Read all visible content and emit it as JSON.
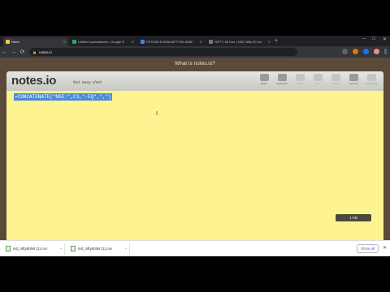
{
  "browser": {
    "tabs": [
      {
        "title": "Notes",
        "favicon_color": "#f2c94c",
        "active": true
      },
      {
        "title": "Untitled spreadsheet - Google S",
        "favicon_color": "#34a853",
        "active": false
      },
      {
        "title": "FETNSE:N:S50LNIFTY50-INDE",
        "favicon_color": "#4285f4",
        "active": false
      },
      {
        "title": "NIFTY 50 Live | NSE Nifty 50 Ind",
        "favicon_color": "#555555",
        "active": false
      }
    ],
    "new_tab": "+",
    "window_controls": [
      "–",
      "□",
      "✕"
    ],
    "nav": {
      "back": "←",
      "forward": "→",
      "reload": "⟳",
      "home": "⌂"
    },
    "url": "notes.io",
    "lock": "🔒"
  },
  "page": {
    "what_is": "What is notes.io?",
    "logo": "notes.io",
    "tagline": "fast. easy. short",
    "actions": [
      {
        "label": "Share",
        "icon": "share-icon",
        "dim": false
      },
      {
        "label": "Facebook",
        "icon": "facebook-icon",
        "dim": false
      },
      {
        "label": "Twitter",
        "icon": "twitter-icon",
        "dim": true
      },
      {
        "label": "Url",
        "icon": "url-icon",
        "dim": true
      },
      {
        "label": "Delete",
        "icon": "delete-icon",
        "dim": true
      },
      {
        "label": "Account",
        "icon": "account-icon",
        "dim": false
      },
      {
        "label": "Sell/Adpage",
        "icon": "sell-icon",
        "dim": true
      }
    ],
    "note_text": "=CONCATENATE(\"NSE:\",C3,\"-EQ\",\",\")",
    "size": "1 KB"
  },
  "downloads": {
    "items": [
      {
        "name": "ind_nifty50list (1).csv"
      },
      {
        "name": "ind_nifty50list (1).csv"
      }
    ],
    "show_all": "Show all",
    "close": "✕"
  }
}
